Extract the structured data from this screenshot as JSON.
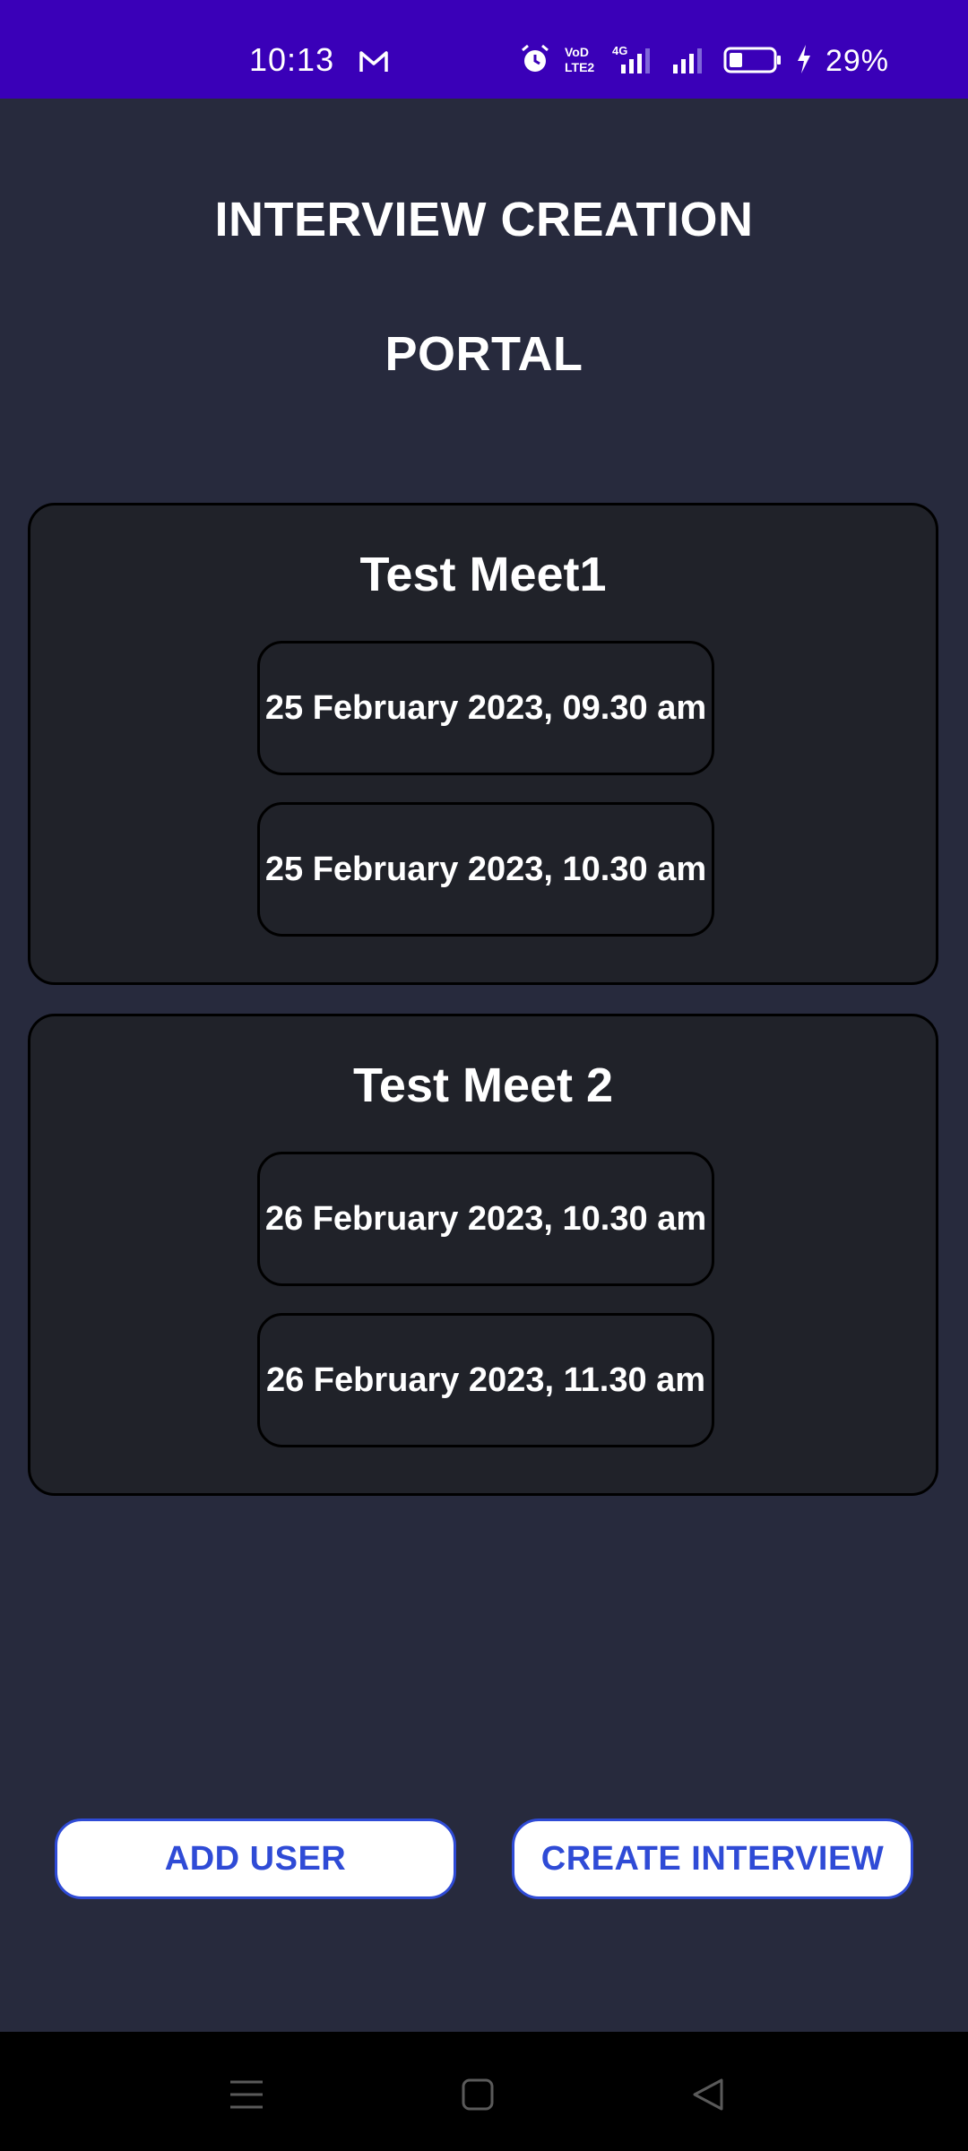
{
  "status_bar": {
    "time": "10:13",
    "battery_percent": "29%",
    "icons": [
      "gmail-icon",
      "alarm-icon",
      "volte-icon",
      "4g-signal-icon",
      "signal-icon",
      "battery-icon",
      "charging-icon"
    ]
  },
  "header": {
    "title_line1": "INTERVIEW CREATION",
    "title_line2": "PORTAL"
  },
  "meetings": [
    {
      "title": "Test Meet1",
      "slots": [
        "25 February 2023, 09.30 am",
        "25 February 2023, 10.30 am"
      ]
    },
    {
      "title": "Test Meet 2",
      "slots": [
        "26 February 2023, 10.30 am",
        "26 February 2023, 11.30 am"
      ]
    }
  ],
  "actions": {
    "add_user_label": "ADD USER",
    "create_interview_label": "CREATE INTERVIEW"
  },
  "colors": {
    "status_bar": "#3a00b8",
    "background": "#272a3d",
    "card": "#202229",
    "button_accent": "#2f4bd6"
  },
  "nav": {
    "icons": [
      "menu-icon",
      "home-icon",
      "back-icon"
    ]
  }
}
